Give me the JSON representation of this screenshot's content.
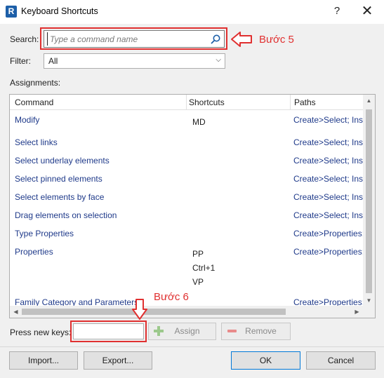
{
  "window": {
    "app_icon_letter": "R",
    "title": "Keyboard Shortcuts",
    "help_label": "?",
    "close_label": "✕"
  },
  "search": {
    "label": "Search:",
    "placeholder": "Type a command name",
    "value": "",
    "icon": "search-icon"
  },
  "filter": {
    "label": "Filter:",
    "value": "All"
  },
  "assignments": {
    "label": "Assignments:",
    "columns": [
      "Command",
      "Shortcuts",
      "Paths"
    ],
    "rows": [
      {
        "command": "Modify",
        "shortcuts": [
          "MD"
        ],
        "path": "Create>Select; Inse"
      },
      {
        "command": "Select links",
        "shortcuts": [],
        "path": "Create>Select; Inse"
      },
      {
        "command": "Select underlay elements",
        "shortcuts": [],
        "path": "Create>Select; Inse"
      },
      {
        "command": "Select pinned elements",
        "shortcuts": [],
        "path": "Create>Select; Inse"
      },
      {
        "command": "Select elements by face",
        "shortcuts": [],
        "path": "Create>Select; Inse"
      },
      {
        "command": "Drag elements on selection",
        "shortcuts": [],
        "path": "Create>Select; Inse"
      },
      {
        "command": "Type Properties",
        "shortcuts": [],
        "path": "Create>Properties;"
      },
      {
        "command": "Properties",
        "shortcuts": [
          "PP",
          "Ctrl+1",
          "VP"
        ],
        "path": "Create>Properties;"
      },
      {
        "command": "Family Category and Parameters",
        "shortcuts": [],
        "path": "Create>Properties;"
      }
    ]
  },
  "press_keys": {
    "label": "Press new keys:",
    "value": ""
  },
  "buttons": {
    "assign": "Assign",
    "remove": "Remove",
    "import": "Import...",
    "export": "Export...",
    "ok": "OK",
    "cancel": "Cancel"
  },
  "annotations": {
    "step5": "Bước 5",
    "step6": "Bước 6",
    "color": "#e03030"
  }
}
